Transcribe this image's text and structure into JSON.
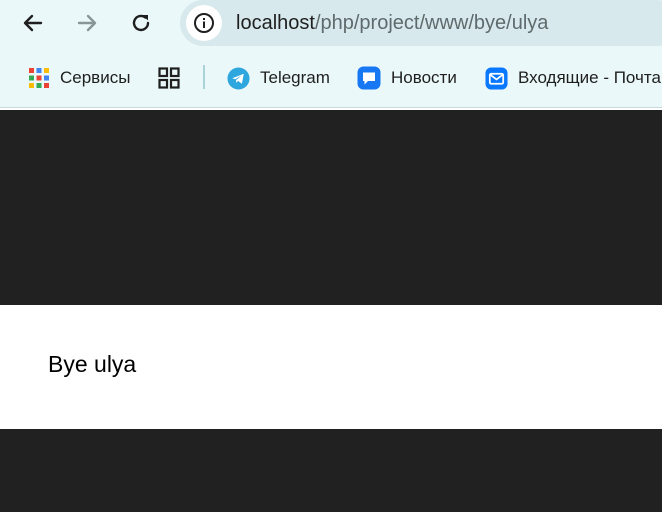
{
  "browser": {
    "url_host": "localhost",
    "url_path": "/php/project/www/bye/ulya",
    "bookmarks": {
      "services": "Сервисы",
      "telegram": "Telegram",
      "news": "Новости",
      "inbox": "Входящие - Почта"
    }
  },
  "page": {
    "content_text": "Bye ulya"
  },
  "colors": {
    "toolbar_bg": "#eaf8f9",
    "omnibox_bg": "#d7e9ec",
    "dark_band": "#212121",
    "content_bg": "#ffffff"
  }
}
